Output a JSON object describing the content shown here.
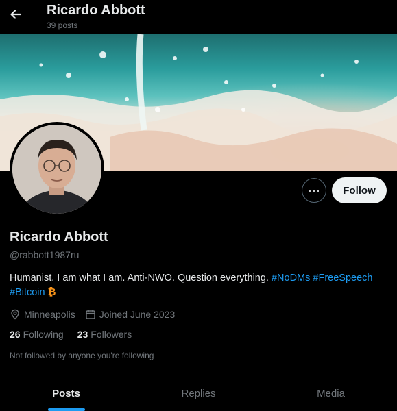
{
  "header": {
    "title": "Ricardo Abbott",
    "post_count": "39 posts"
  },
  "profile": {
    "display_name": "Ricardo Abbott",
    "handle": "@rabbott1987ru",
    "bio_text": "Humanist. I am what I am. Anti-NWO. Question everything.",
    "bio_tags": [
      "#NoDMs",
      "#FreeSpeech",
      "#Bitcoin"
    ],
    "bio_emoji": "₿",
    "location": "Minneapolis",
    "joined": "Joined June 2023",
    "following_count": "26",
    "following_label": "Following",
    "followers_count": "23",
    "followers_label": "Followers",
    "not_followed_text": "Not followed by anyone you're following"
  },
  "actions": {
    "more_label": "···",
    "follow_label": "Follow"
  },
  "tabs": [
    {
      "label": "Posts",
      "active": true
    },
    {
      "label": "Replies",
      "active": false
    },
    {
      "label": "Media",
      "active": false
    }
  ],
  "colors": {
    "accent": "#1d9bf0",
    "secondary_text": "#71767b",
    "background": "#000000",
    "bitcoin": "#f7931a"
  },
  "icons": {
    "back": "arrow-left-icon",
    "location": "location-pin-icon",
    "calendar": "calendar-icon",
    "more": "more-dots-icon"
  }
}
